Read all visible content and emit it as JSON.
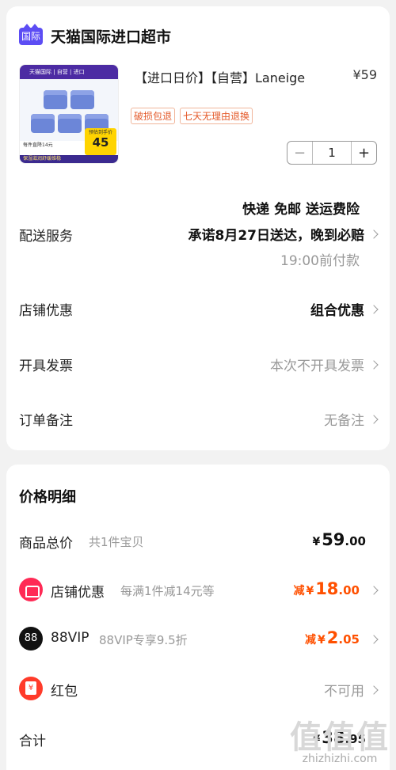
{
  "store": {
    "logo_text": "国际",
    "name": "天猫国际进口超市"
  },
  "product": {
    "title": "【进口日价】【自营】Laneige",
    "price": "¥59",
    "tags": [
      "破损包退",
      "七天无理由退换"
    ],
    "quantity": "1",
    "minus": "−",
    "plus": "+",
    "thumb": {
      "top_text": "天猫国际 | 自营 | 进口",
      "bottom_left": "每件直降14元",
      "strip_text": "保湿滋润舒缓维稳",
      "badge_label": "预估到手价",
      "badge_price": "45"
    }
  },
  "delivery": {
    "label": "配送服务",
    "line1": "快递 免邮 送运费险",
    "line2": "承诺8月27日送达，晚到必赔",
    "line3": "19:00前付款"
  },
  "store_discount_row": {
    "label": "店铺优惠",
    "value": "组合优惠"
  },
  "invoice_row": {
    "label": "开具发票",
    "value": "本次不开具发票"
  },
  "note_row": {
    "label": "订单备注",
    "value": "无备注"
  },
  "price_detail": {
    "title": "价格明细",
    "goods_total": {
      "label": "商品总价",
      "sub": "共1件宝贝",
      "currency": "¥",
      "int": "59",
      "dec": ".00"
    },
    "shop_discount": {
      "label": "店铺优惠",
      "sub": "每满1件减14元等",
      "prefix": "减",
      "currency": "¥",
      "int": "18",
      "dec": ".00"
    },
    "vip": {
      "icon_text": "88",
      "label": "88VIP",
      "sub": "88VIP专享9.5折",
      "prefix": "减",
      "currency": "¥",
      "int": "2",
      "dec": ".05"
    },
    "red_packet": {
      "label": "红包",
      "value": "不可用"
    },
    "total": {
      "label": "合计",
      "currency": "¥",
      "int": "38",
      "dec": ".95"
    }
  },
  "watermark": {
    "big": "值值值",
    "url": "zhizhizhi.com"
  },
  "colors": {
    "accent": "#ff5000",
    "tmall_purple": "#5c4df4",
    "tag_red": "#e45a2a"
  }
}
